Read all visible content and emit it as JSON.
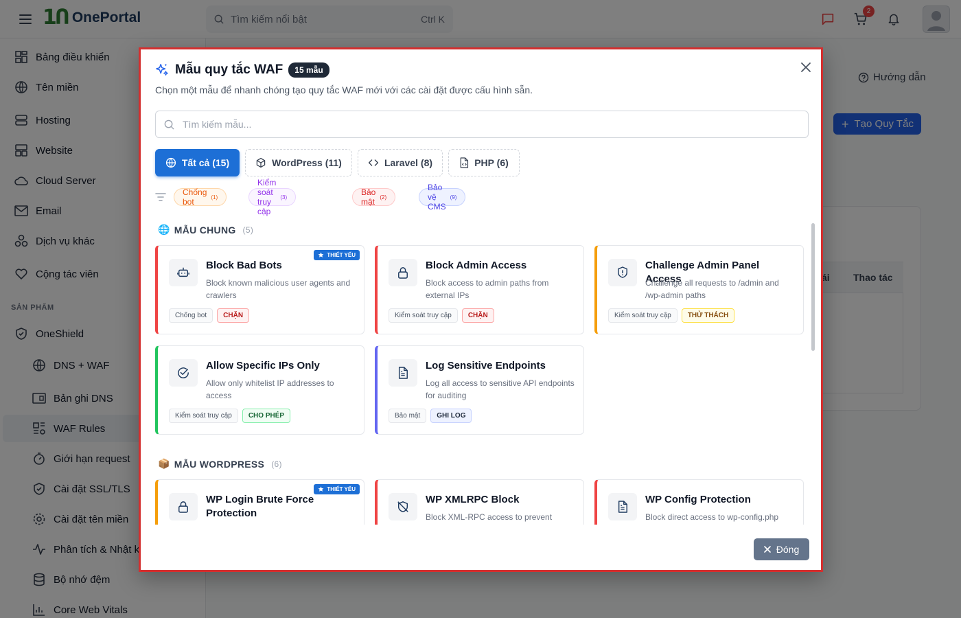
{
  "app": {
    "logo_text": "OnePortal",
    "search_placeholder": "Tìm kiếm nổi bật",
    "search_shortcut": "Ctrl K",
    "cart_count": "2"
  },
  "sidebar": {
    "items": [
      {
        "label": "Bảng điều khiển",
        "icon": "dashboard-icon"
      },
      {
        "label": "Tên miền",
        "icon": "globe-icon"
      },
      {
        "label": "Hosting",
        "icon": "server-icon"
      },
      {
        "label": "Website",
        "icon": "layout-icon"
      },
      {
        "label": "Cloud Server",
        "icon": "cloud-icon"
      },
      {
        "label": "Email",
        "icon": "mail-icon"
      },
      {
        "label": "Dịch vụ khác",
        "icon": "apps-icon"
      },
      {
        "label": "Cộng tác viên",
        "icon": "handshake-icon"
      }
    ],
    "section_label": "SẢN PHẨM",
    "product": {
      "label": "OneShield",
      "icon": "shield-icon"
    },
    "sub_items": [
      {
        "label": "DNS + WAF",
        "icon": "globe-icon"
      },
      {
        "label": "Bản ghi DNS",
        "icon": "dns-record-icon"
      },
      {
        "label": "WAF Rules",
        "icon": "waf-rules-icon"
      },
      {
        "label": "Giới hạn request",
        "icon": "timer-icon"
      },
      {
        "label": "Cài đặt SSL/TLS",
        "icon": "shield-check-icon"
      },
      {
        "label": "Cài đặt tên miền",
        "icon": "gear-icon"
      },
      {
        "label": "Phân tích & Nhật ký",
        "icon": "activity-icon"
      },
      {
        "label": "Bộ nhớ đệm",
        "icon": "database-icon"
      },
      {
        "label": "Core Web Vitals",
        "icon": "bar-chart-icon"
      }
    ]
  },
  "page": {
    "guide_label": "Hướng dẫn",
    "create_rule_label": "Tạo Quy Tắc",
    "table_col_partial": "ái",
    "table_col_actions": "Thao tác"
  },
  "modal": {
    "title": "Mẫu quy tắc WAF",
    "count_badge": "15 mẫu",
    "description": "Chọn một mẫu để nhanh chóng tạo quy tắc WAF mới với các cài đặt được cấu hình sẵn.",
    "search_placeholder": "Tìm kiếm mẫu...",
    "tabs": [
      {
        "label": "Tất cả",
        "count": "(15)",
        "icon": "globe-icon",
        "active": true
      },
      {
        "label": "WordPress",
        "count": "(11)",
        "icon": "box-icon",
        "active": false
      },
      {
        "label": "Laravel",
        "count": "(8)",
        "icon": "code-icon",
        "active": false
      },
      {
        "label": "PHP",
        "count": "(6)",
        "icon": "file-code-icon",
        "active": false
      }
    ],
    "chips": [
      {
        "label": "Chống bot",
        "count": "(1)",
        "bg": "#fff7ed",
        "fg": "#ea580c",
        "border": "#fed7aa"
      },
      {
        "label": "Kiểm soát truy cập",
        "count": "(3)",
        "bg": "#faf5ff",
        "fg": "#9333ea",
        "border": "#e9d5ff"
      },
      {
        "label": "Bảo mật",
        "count": "(2)",
        "bg": "#fef2f2",
        "fg": "#dc2626",
        "border": "#fecaca"
      },
      {
        "label": "Bảo vệ CMS",
        "count": "(9)",
        "bg": "#eef2ff",
        "fg": "#4f46e5",
        "border": "#c7d2fe"
      }
    ],
    "sections": [
      {
        "emoji": "🌐",
        "title": "MẪU CHUNG",
        "count": "(5)",
        "cards": [
          {
            "title": "Block Bad Bots",
            "desc": "Block known malicious user agents and crawlers",
            "category": "Chống bot",
            "action": "CHẶN",
            "action_type": "block",
            "accent": "#ef4444",
            "icon": "bot-icon",
            "essential": true
          },
          {
            "title": "Block Admin Access",
            "desc": "Block access to admin paths from external IPs",
            "category": "Kiểm soát truy cập",
            "action": "CHẶN",
            "action_type": "block",
            "accent": "#ef4444",
            "icon": "lock-icon",
            "essential": false
          },
          {
            "title": "Challenge Admin Panel Access",
            "desc": "Challenge all requests to /admin and /wp-admin paths",
            "category": "Kiểm soát truy cập",
            "action": "THỬ THÁCH",
            "action_type": "challenge",
            "accent": "#f59e0b",
            "icon": "shield-alert-icon",
            "essential": false
          },
          {
            "title": "Allow Specific IPs Only",
            "desc": "Allow only whitelist IP addresses to access",
            "category": "Kiểm soát truy cập",
            "action": "CHO PHÉP",
            "action_type": "allow",
            "accent": "#22c55e",
            "icon": "check-circle-icon",
            "essential": false
          },
          {
            "title": "Log Sensitive Endpoints",
            "desc": "Log all access to sensitive API endpoints for auditing",
            "category": "Bảo mật",
            "action": "GHI LOG",
            "action_type": "log",
            "accent": "#6366f1",
            "icon": "file-text-icon",
            "essential": false
          }
        ]
      },
      {
        "emoji": "📦",
        "title": "MẪU WORDPRESS",
        "count": "(6)",
        "cards": [
          {
            "title": "WP Login Brute Force Protection",
            "desc": "",
            "category": "",
            "action": "",
            "action_type": "challenge",
            "accent": "#f59e0b",
            "icon": "lock-icon",
            "essential": true
          },
          {
            "title": "WP XMLRPC Block",
            "desc": "Block XML-RPC access to prevent",
            "category": "",
            "action": "",
            "action_type": "block",
            "accent": "#ef4444",
            "icon": "shield-off-icon",
            "essential": false
          },
          {
            "title": "WP Config Protection",
            "desc": "Block direct access to wp-config.php",
            "category": "",
            "action": "",
            "action_type": "block",
            "accent": "#ef4444",
            "icon": "file-text-icon",
            "essential": false
          }
        ]
      }
    ],
    "essential_label": "THIẾT YẾU",
    "close_label": "Đóng"
  },
  "colors": {
    "primary": "#1d6fd6",
    "block_bg": "#fef2f2",
    "block_fg": "#b91c1c",
    "block_border": "#fca5a5",
    "challenge_bg": "#fefce8",
    "challenge_fg": "#854d0e",
    "challenge_border": "#fde047",
    "allow_bg": "#f0fdf4",
    "allow_fg": "#166534",
    "allow_border": "#86efac",
    "log_bg": "#eef2ff",
    "log_fg": "#1e293b",
    "log_border": "#c7d2fe"
  }
}
